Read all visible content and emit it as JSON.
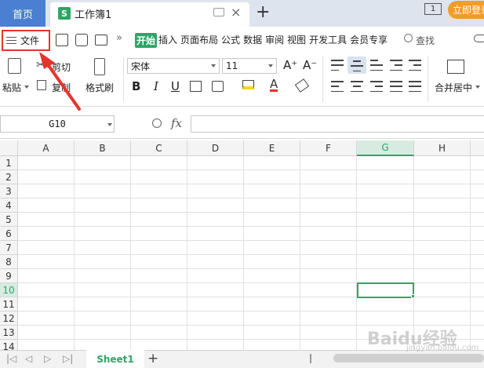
{
  "titlebar": {
    "home_tab": "首页",
    "doc_icon_letter": "S",
    "doc_title": "工作簿1",
    "badge": "1",
    "login_button": "立即登录"
  },
  "menu": {
    "file_label": "文件",
    "tabs": [
      "开始",
      "插入",
      "页面布局",
      "公式",
      "数据",
      "审阅",
      "视图",
      "开发工具",
      "会员专享"
    ],
    "search_label": "查找"
  },
  "ribbon": {
    "paste_label": "粘贴",
    "cut_label": "剪切",
    "copy_label": "复制",
    "format_painter_label": "格式刷",
    "font_name": "宋体",
    "font_size": "11",
    "increase_font": "A⁺",
    "decrease_font": "A⁻",
    "bold": "B",
    "italic": "I",
    "underline": "U",
    "merge_label": "合并居中"
  },
  "formula_bar": {
    "name_box": "G10",
    "fx_label": "fx",
    "formula_value": ""
  },
  "grid": {
    "columns": [
      "A",
      "B",
      "C",
      "D",
      "E",
      "F",
      "G",
      "H"
    ],
    "rows": [
      "1",
      "2",
      "3",
      "4",
      "5",
      "6",
      "7",
      "8",
      "9",
      "10",
      "11",
      "12",
      "13",
      "14"
    ],
    "active_column": "G",
    "active_row": "10"
  },
  "sheets": {
    "tabs": [
      "Sheet1"
    ],
    "add_label": "+"
  },
  "colors": {
    "accent_green": "#2ea566",
    "home_tab_blue": "#4a7fd1",
    "login_orange": "#f29c2b",
    "annotation_red": "#e8322c"
  },
  "watermark": {
    "text": "Baidu经验",
    "sub": "jingyan.baidu.com"
  }
}
